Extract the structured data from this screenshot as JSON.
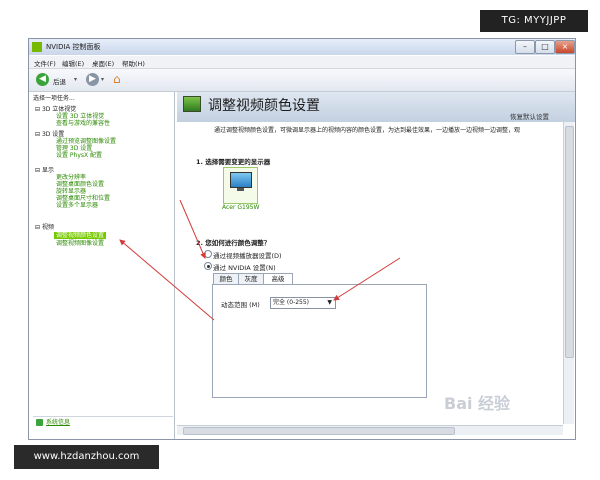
{
  "window": {
    "title": "NVIDIA 控制面板"
  },
  "menubar": {
    "file": "文件(F)",
    "edit": "编辑(E)",
    "desktop": "桌面(E)",
    "help": "帮助(H)"
  },
  "toolbar": {
    "back_label": "后退"
  },
  "sidebar": {
    "heading": "选择一项任务...",
    "categories": [
      {
        "label": "3D 立体视觉",
        "items": [
          "设置 3D 立体视觉",
          "查看与游戏的兼容性"
        ]
      },
      {
        "label": "3D 设置",
        "items": [
          "通过预览调整图像设置",
          "管理 3D 设置",
          "设置 PhysX 配置"
        ]
      },
      {
        "label": "显示",
        "items": [
          "更改分辨率",
          "调整桌面颜色设置",
          "旋转显示器",
          "调整桌面尺寸和位置",
          "设置多个显示器"
        ]
      },
      {
        "label": "视频",
        "items": [
          "调整视频颜色设置",
          "调整视频图像设置"
        ]
      }
    ],
    "system_info": "系统信息"
  },
  "main": {
    "title": "调整视频颜色设置",
    "restore_defaults": "恢复默认设置",
    "description": "通过调整视频颜色设置，可微调显示器上的视频内容的颜色设置，为达到最佳效果，一边播放一边视频一边调整，观",
    "section1": "1. 选择需要变更的显示器",
    "display_name": "Acer G195W",
    "section2": "2. 您如何进行颜色调整？",
    "option_player": "通过视频播放器设置(D)",
    "option_nvidia": "通过 NVIDIA 设置(N)",
    "tabs": [
      "颜色",
      "灰度",
      "高级"
    ],
    "dynamic_range_label": "动态范围 (M)",
    "dynamic_range_value": "完全 (0-255)"
  },
  "watermarks": {
    "top_right": "TG: MYYJJPP",
    "bottom_left": "www.hzdanzhou.com",
    "baidu": "Bai 经验"
  },
  "colors": {
    "nvidia_green": "#76b900",
    "arrow_red": "#d43a3a",
    "link_green": "#2a8a00"
  }
}
